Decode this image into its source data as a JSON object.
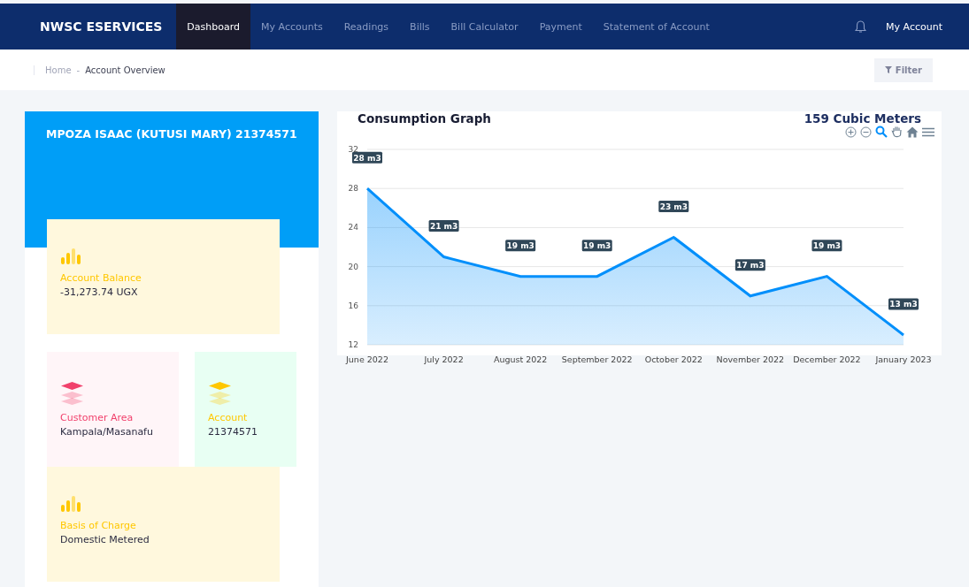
{
  "brand": "NWSC ESERVICES",
  "nav": [
    {
      "label": "Dashboard",
      "selected": true
    },
    {
      "label": "My Accounts",
      "selected": false
    },
    {
      "label": "Readings",
      "selected": false
    },
    {
      "label": "Bills",
      "selected": false
    },
    {
      "label": "Bill Calculator",
      "selected": false
    },
    {
      "label": "Payment",
      "selected": false
    },
    {
      "label": "Statement of Account",
      "selected": false
    }
  ],
  "account_menu": "My Account",
  "breadcrumb": {
    "home": "Home",
    "separator": "-",
    "current": "Account Overview"
  },
  "filter_button": "Filter",
  "profile": {
    "title": "MPOZA ISAAC (KUTUSI MARY) 21374571",
    "cards": [
      {
        "kind": "bars",
        "label": "Account Balance",
        "value": "-31,273.74 UGX",
        "color": "#ffc700"
      },
      {
        "kind": "layers",
        "label": "Customer Area",
        "value": "Kampala/Masanafu",
        "color": "#f1416c"
      },
      {
        "kind": "layers",
        "label": "Account",
        "value": "21374571",
        "color": "#ffc700"
      },
      {
        "kind": "bars",
        "label": "Basis of Charge",
        "value": "Domestic Metered",
        "color": "#ffc700"
      }
    ]
  },
  "chart": {
    "title": "Consumption Graph",
    "total": "159 Cubic Meters",
    "chart_data": {
      "type": "area",
      "categories": [
        "June 2022",
        "July 2022",
        "August 2022",
        "September 2022",
        "October 2022",
        "November 2022",
        "December 2022",
        "January 2023"
      ],
      "series": [
        {
          "color": "#008ffb",
          "values": [
            28,
            21,
            19,
            19,
            23,
            17,
            19,
            13
          ]
        }
      ],
      "ylim": [
        12,
        32
      ],
      "grid": true,
      "yticks": [
        12,
        16,
        20,
        24,
        28,
        32
      ],
      "value_labels": [
        "28 m3",
        "21 m3",
        "19 m3",
        "19 m3",
        "23 m3",
        "17 m3",
        "19 m3",
        "13 m3"
      ]
    }
  }
}
